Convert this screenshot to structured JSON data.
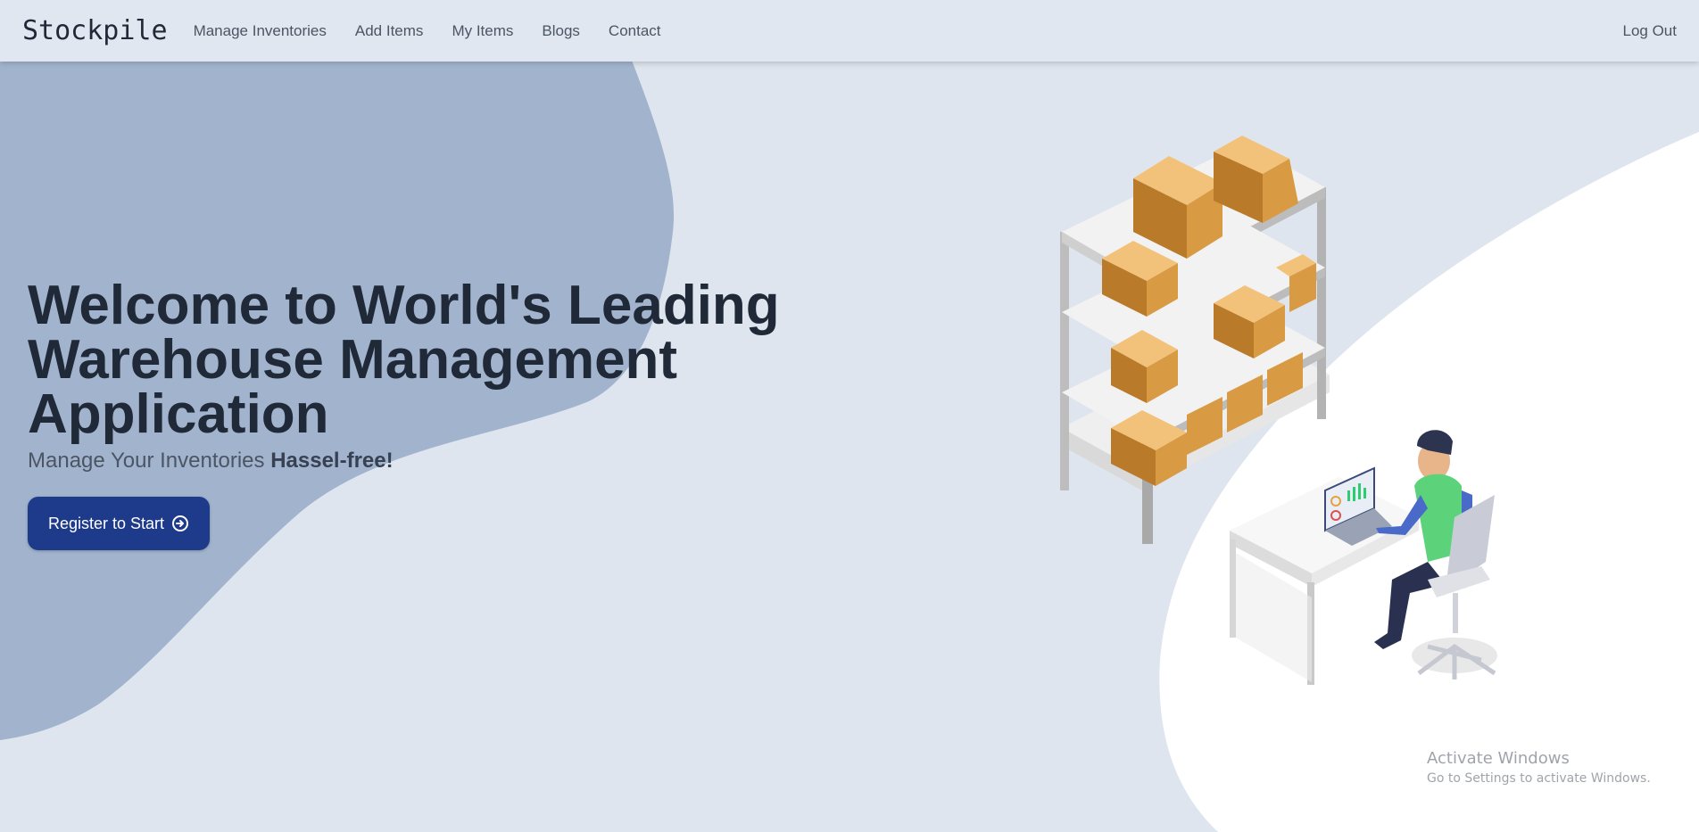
{
  "app": {
    "brand": "Stockpile"
  },
  "nav": {
    "items": [
      "Manage Inventories",
      "Add Items",
      "My Items",
      "Blogs",
      "Contact"
    ],
    "logout": "Log Out"
  },
  "hero": {
    "title": "Welcome to World's Leading Warehouse Management Application",
    "subtitle_prefix": "Manage Your Inventories ",
    "subtitle_bold": "Hassel-free!",
    "cta_label": "Register to Start",
    "cta_icon": "arrow-right-circle-icon"
  },
  "illustration": {
    "icon": "warehouse-worker-illustration"
  },
  "watermark": {
    "title": "Activate Windows",
    "subtitle": "Go to Settings to activate Windows."
  },
  "colors": {
    "background": "#dfe5ee",
    "blob": "#a2b4cd",
    "cta": "#1e3a8a",
    "text": "#1f2937"
  }
}
